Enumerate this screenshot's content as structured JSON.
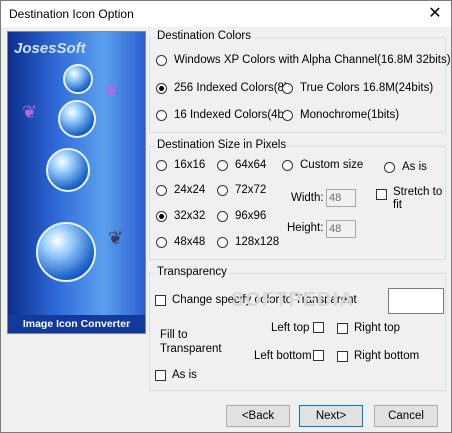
{
  "window": {
    "title": "Destination Icon Option",
    "close": "✕"
  },
  "side": {
    "brand": "JosesSoft",
    "caption": "Image Icon Converter"
  },
  "colors": {
    "legend": "Destination Colors",
    "options": [
      {
        "label": "Windows XP Colors with Alpha Channel(16.8M 32bits)",
        "selected": false
      },
      {
        "label": "256 Indexed Colors(8b",
        "selected": true
      },
      {
        "label": "True Colors 16.8M(24bits)",
        "selected": false
      },
      {
        "label": "16 Indexed Colors(4b",
        "selected": false
      },
      {
        "label": "Monochrome(1bits)",
        "selected": false
      }
    ]
  },
  "size": {
    "legend": "Destination Size in Pixels",
    "options": [
      {
        "label": "16x16",
        "selected": false
      },
      {
        "label": "64x64",
        "selected": false
      },
      {
        "label": "Custom size",
        "selected": false
      },
      {
        "label": "As is",
        "selected": false
      },
      {
        "label": "24x24",
        "selected": false
      },
      {
        "label": "72x72",
        "selected": false
      },
      {
        "label": "32x32",
        "selected": true
      },
      {
        "label": "96x96",
        "selected": false
      },
      {
        "label": "48x48",
        "selected": false
      },
      {
        "label": "128x128",
        "selected": false
      }
    ],
    "width_label": "Width:",
    "width_value": "48",
    "height_label": "Height:",
    "height_value": "48",
    "stretch_line1": "Stretch to",
    "stretch_line2": "fit",
    "stretch_checked": false
  },
  "transparency": {
    "legend": "Transparency",
    "change_color": "Change specify color to Transparent",
    "change_checked": false,
    "fill_line1": "Fill to",
    "fill_line2": "Transparent",
    "left_top": "Left top",
    "right_top": "Right top",
    "left_bottom": "Left bottom",
    "right_bottom": "Right bottom",
    "as_is": "As is"
  },
  "watermark": "SOFTPEDIA",
  "buttons": {
    "back": "<Back",
    "next": "Next>",
    "cancel": "Cancel"
  }
}
